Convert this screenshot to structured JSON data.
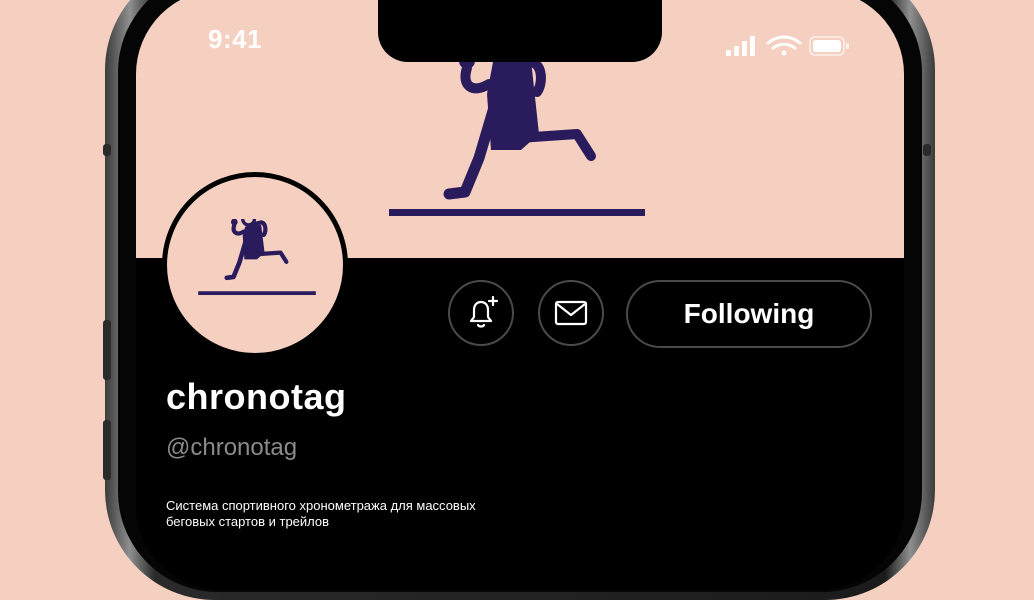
{
  "status_bar": {
    "time": "9:41",
    "icons": [
      "signal-icon",
      "wifi-icon",
      "battery-icon"
    ]
  },
  "profile": {
    "display_name": "chronotag",
    "handle": "@chronotag",
    "bio": "Система спортивного хронометража для массовых беговых стартов и трейлов"
  },
  "actions": {
    "notify_icon": "bell-plus-icon",
    "message_icon": "mail-icon",
    "follow_label": "Following"
  },
  "colors": {
    "background": "#f5d0c1",
    "logo": "#2a1b5c",
    "screen": "#000000",
    "text": "#ffffff",
    "muted": "#8a8a8a"
  }
}
